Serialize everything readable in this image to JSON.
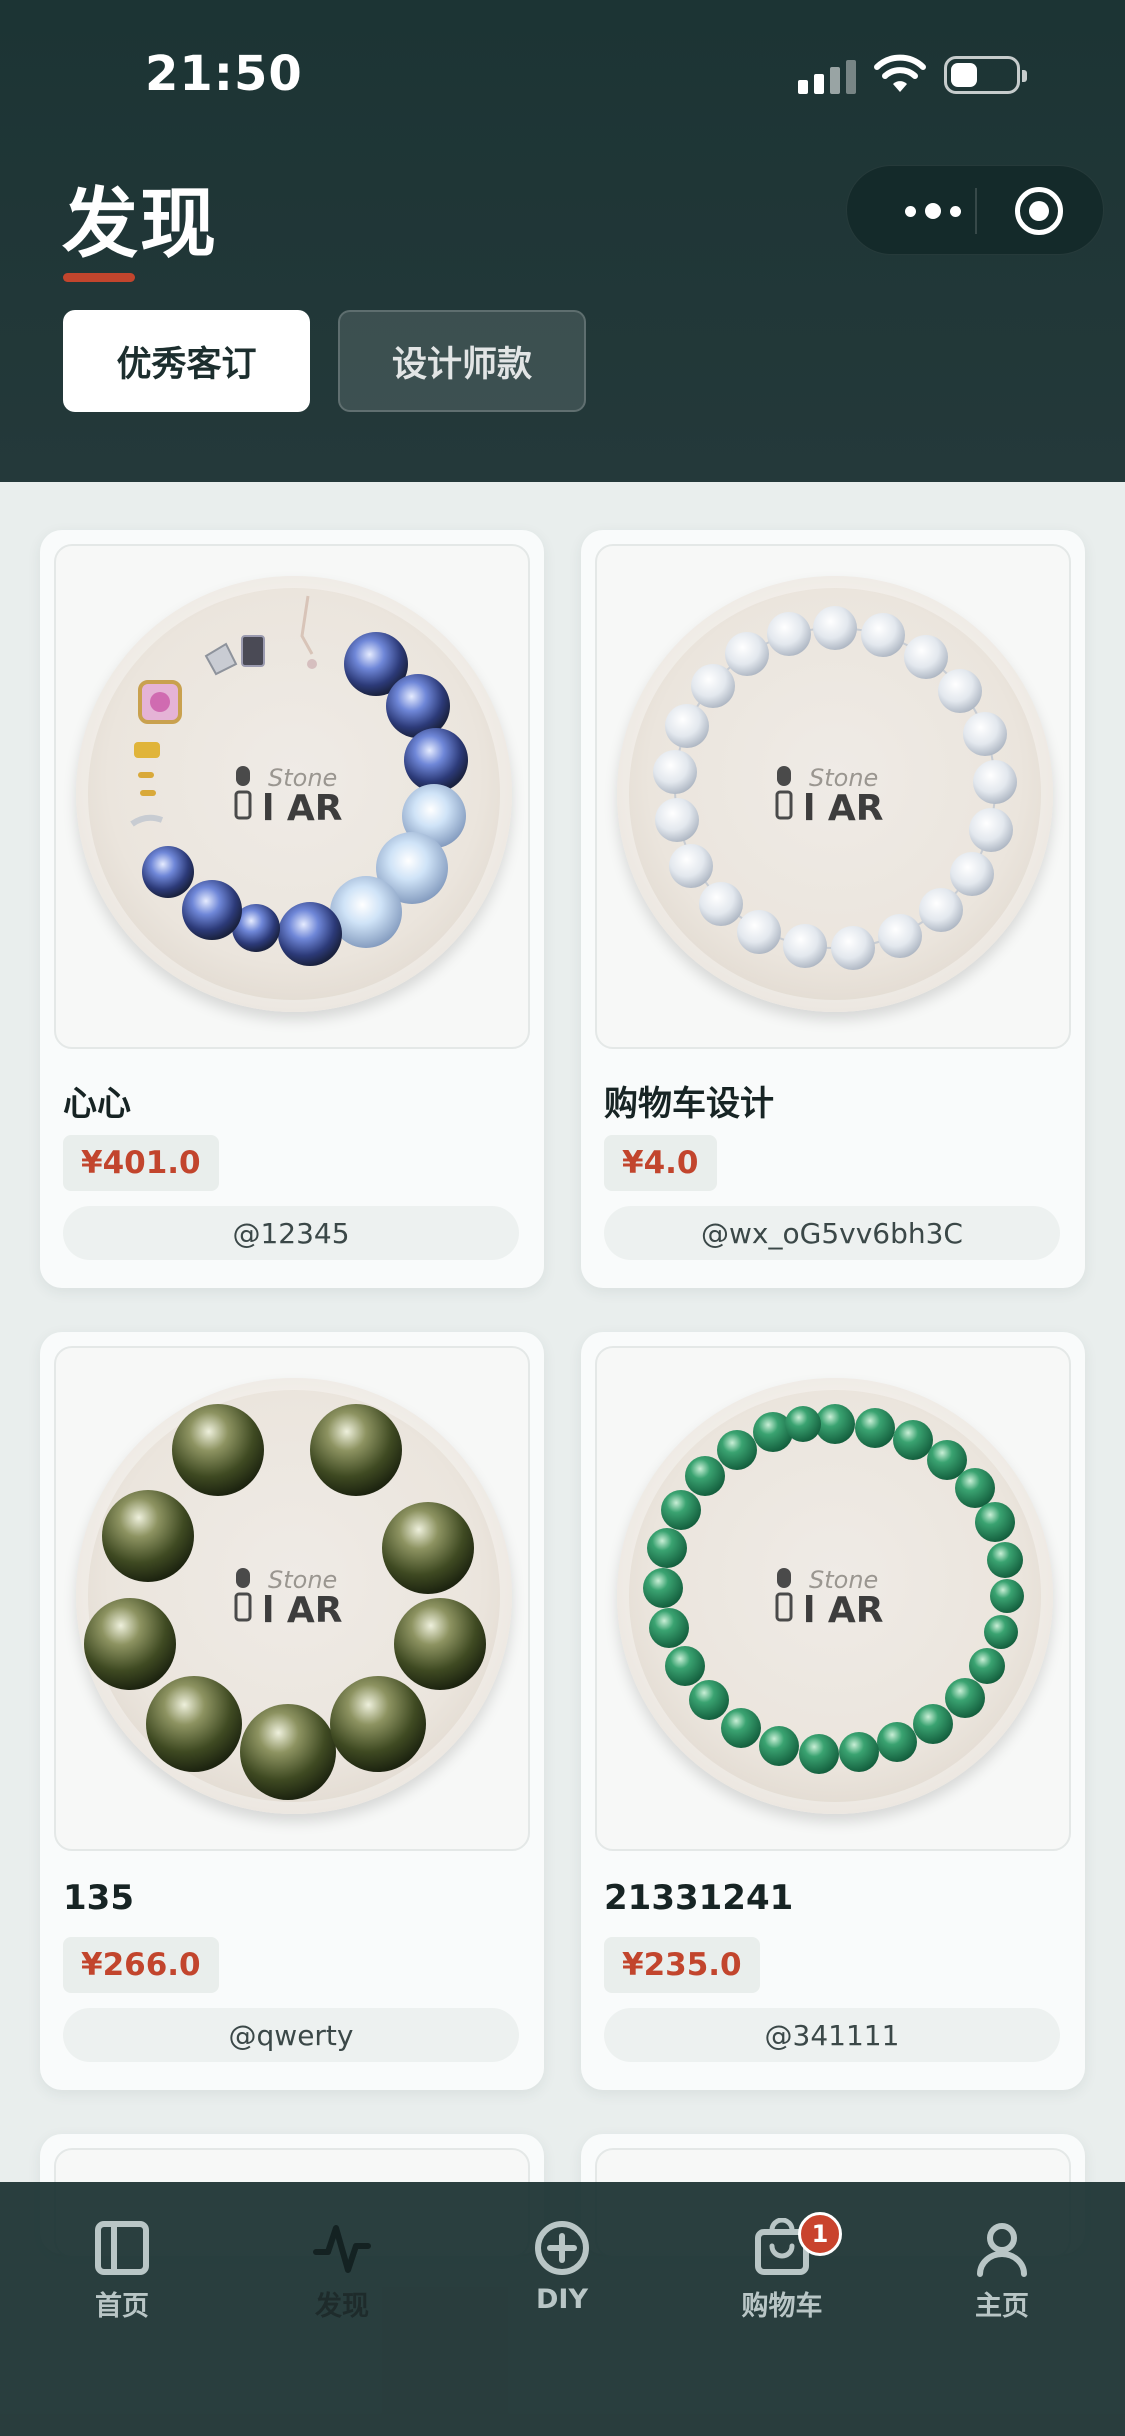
{
  "status_bar": {
    "time": "21:50"
  },
  "header": {
    "title": "发现",
    "tabs": [
      {
        "label": "优秀客订",
        "active": true
      },
      {
        "label": "设计师款",
        "active": false
      }
    ]
  },
  "colors": {
    "accent": "#c2452d",
    "header_bg": "#1c3434",
    "price": "#c2452d"
  },
  "products": [
    {
      "name": "心心",
      "price": "¥401.0",
      "author": "@12345",
      "bead_style": "blue-moonstone-with-charms"
    },
    {
      "name": "购物车设计",
      "price": "¥4.0",
      "author": "@wx_oG5vv6bh3C",
      "bead_style": "clear-quartz"
    },
    {
      "name": "135",
      "price": "¥266.0",
      "author": "@qwerty",
      "bead_style": "green-phantom"
    },
    {
      "name": "21331241",
      "price": "¥235.0",
      "author": "@341111",
      "bead_style": "green-aventurine"
    }
  ],
  "bottom_nav": {
    "items": [
      {
        "label": "首页",
        "icon": "home-icon"
      },
      {
        "label": "发现",
        "icon": "pulse-icon",
        "active": true
      },
      {
        "label": "DIY",
        "icon": "plus-circle-icon"
      },
      {
        "label": "购物车",
        "icon": "shopping-bag-icon",
        "badge": "1"
      },
      {
        "label": "主页",
        "icon": "user-icon"
      }
    ]
  }
}
